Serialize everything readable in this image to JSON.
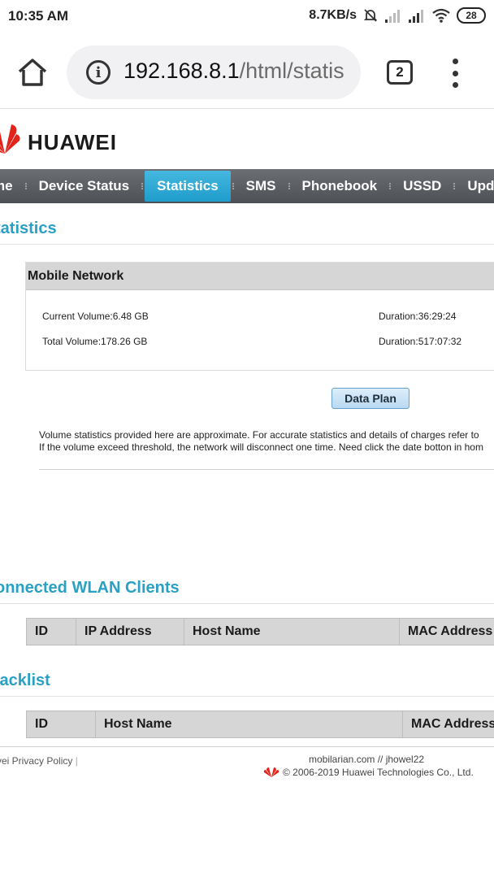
{
  "status_bar": {
    "time": "10:35 AM",
    "speed": "8.7KB/s",
    "battery": "28"
  },
  "browser": {
    "url_host": "192.168.8.1",
    "url_path": "/html/statis",
    "tab_count": "2"
  },
  "header": {
    "brand": "HUAWEI",
    "brand_color": "#e2231a"
  },
  "nav": {
    "items": [
      {
        "label": "me"
      },
      {
        "label": "Device Status"
      },
      {
        "label": "Statistics"
      },
      {
        "label": "SMS"
      },
      {
        "label": "Phonebook"
      },
      {
        "label": "USSD"
      },
      {
        "label": "Upda"
      }
    ],
    "active_label": "Statistics",
    "active_color": "#2aa7d6"
  },
  "statistics": {
    "title": "tatistics",
    "mobile_network": {
      "heading": "Mobile Network",
      "current_volume": "Current Volume:6.48 GB",
      "current_duration": "Duration:36:29:24",
      "total_volume": "Total Volume:178.26 GB",
      "total_duration": "Duration:517:07:32"
    },
    "data_plan_button": "Data Plan",
    "note_line1": "Volume statistics provided here are approximate. For accurate statistics and details of charges refer to",
    "note_line2": "If the volume exceed threshold, the network will disconnect one time. Need click the date botton in hom"
  },
  "wlan_clients": {
    "title": "onnected WLAN Clients",
    "columns": [
      "ID",
      "IP Address",
      "Host Name",
      "MAC Address"
    ]
  },
  "blacklist": {
    "title": "lacklist",
    "columns": [
      "ID",
      "Host Name",
      "MAC Address"
    ]
  },
  "footer": {
    "privacy": "vei Privacy Policy",
    "separator": "|",
    "credit": "mobilarian.com // jhowel22",
    "copyright": "© 2006-2019 Huawei Technologies Co., Ltd."
  }
}
